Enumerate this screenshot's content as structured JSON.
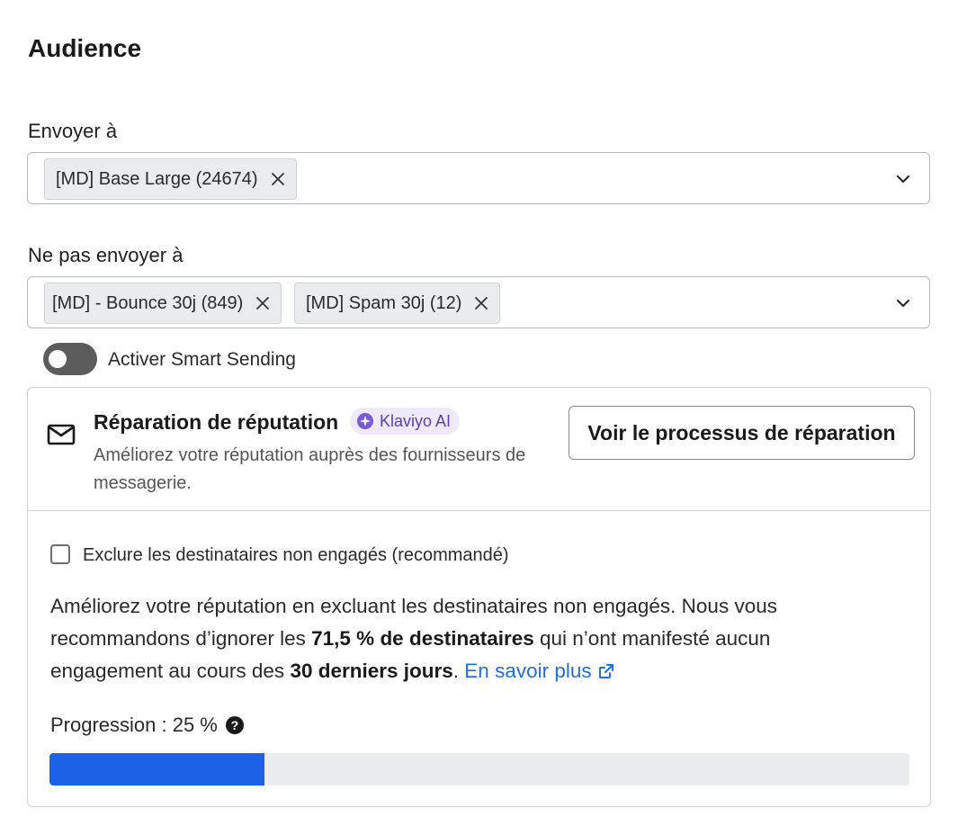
{
  "audience": {
    "title": "Audience",
    "send_to": {
      "label": "Envoyer à",
      "chips": [
        "[MD] Base Large (24674)"
      ]
    },
    "exclude": {
      "label": "Ne pas envoyer à",
      "chips": [
        "[MD] - Bounce 30j (849)",
        "[MD] Spam 30j (12)"
      ]
    },
    "smart_sending": {
      "label": "Activer Smart Sending",
      "enabled": false
    }
  },
  "reputation_card": {
    "title": "Réparation de réputation",
    "badge": "Klaviyo AI",
    "description": "Améliorez votre réputation auprès des fournisseurs de messagerie.",
    "button_label": "Voir le processus de réparation",
    "checkbox_label": "Exclure les destinataires non engagés (recommandé)",
    "checkbox_checked": false,
    "info": {
      "part1": "Améliorez votre réputation en excluant les destinataires non engagés. Nous vous recommandons d’ignorer les ",
      "bold1": "71,5 % de destinataires",
      "part2": " qui n’ont manifesté aucun engagement au cours des ",
      "bold2": "30 derniers jours",
      "part3": ". ",
      "link": "En savoir plus"
    },
    "progress_label": "Progression : 25 %",
    "progress_percent": 25
  },
  "colors": {
    "accent": "#1b62e8",
    "link": "#1f6fdc",
    "badge_bg": "#efe9fb",
    "toggle_off": "#5c5c5c"
  }
}
